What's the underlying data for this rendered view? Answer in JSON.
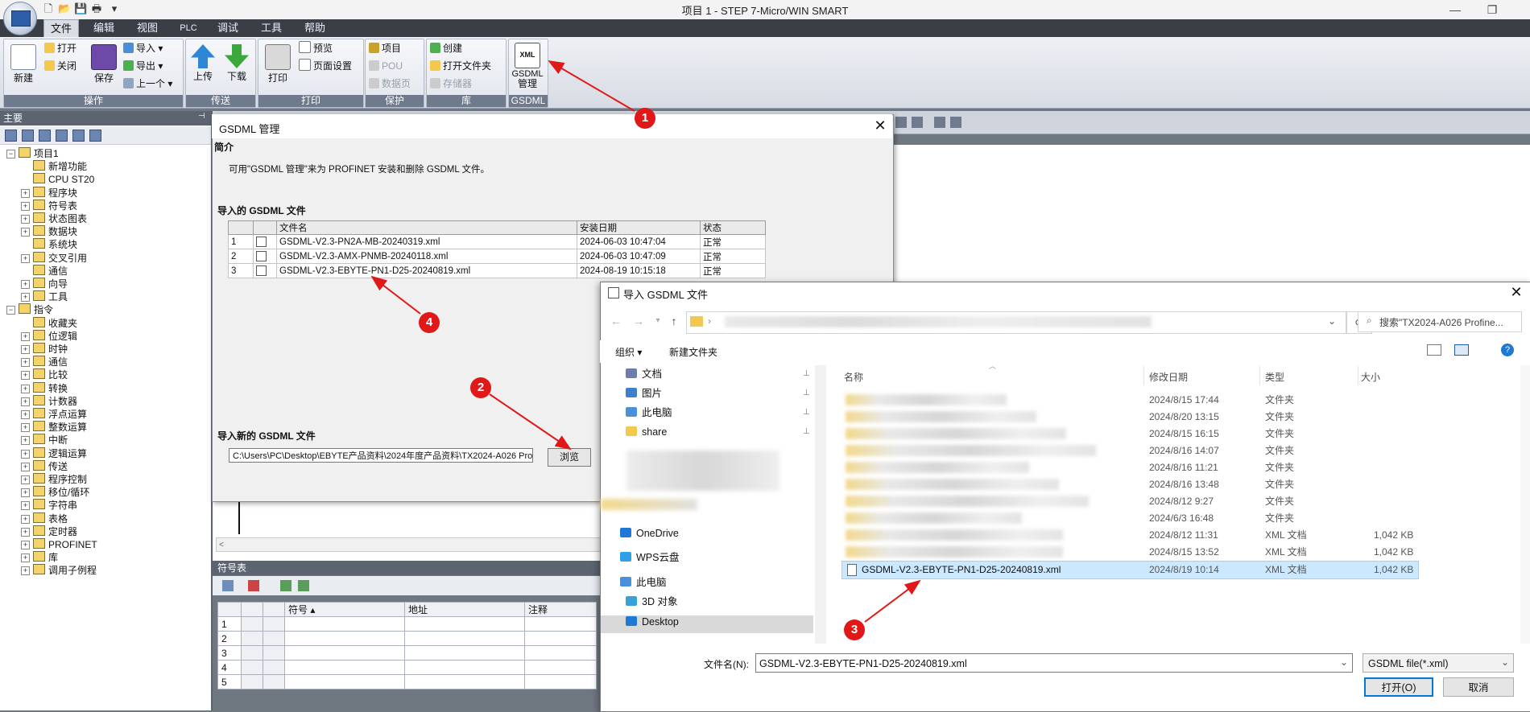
{
  "window": {
    "title": "项目 1 - STEP 7-Micro/WIN SMART",
    "controls": [
      "—",
      "❐"
    ]
  },
  "menu": {
    "tabs": [
      "文件",
      "编辑",
      "视图",
      "PLC",
      "调试",
      "工具",
      "帮助"
    ],
    "active": "文件"
  },
  "ribbon": {
    "ops": {
      "label": "操作",
      "new": "新建",
      "open": "打开",
      "close": "关闭",
      "save": "保存",
      "import": "导入 ▾",
      "export": "导出 ▾",
      "prev": "上一个 ▾"
    },
    "transfer": {
      "label": "传送",
      "upload": "上传",
      "download": "下载"
    },
    "print": {
      "label": "打印",
      "print": "打印",
      "preview": "预览",
      "page_setup": "页面设置"
    },
    "protect": {
      "label": "保护",
      "project": "项目",
      "pou": "POU",
      "data_page": "数据页"
    },
    "library": {
      "label": "库",
      "create": "创建",
      "open_folder": "打开文件夹",
      "storage": "存储器"
    },
    "gsdml": {
      "label": "GSDML",
      "btn_line1": "GSDML",
      "btn_line2": "管理",
      "icon_text": "XML"
    }
  },
  "left_panel": {
    "header": "主要",
    "tree": [
      {
        "label": "项目1",
        "exp": "−",
        "indent": 0
      },
      {
        "label": "新增功能",
        "exp": "",
        "indent": 1
      },
      {
        "label": "CPU ST20",
        "exp": "",
        "indent": 1
      },
      {
        "label": "程序块",
        "exp": "+",
        "indent": 1
      },
      {
        "label": "符号表",
        "exp": "+",
        "indent": 1
      },
      {
        "label": "状态图表",
        "exp": "+",
        "indent": 1
      },
      {
        "label": "数据块",
        "exp": "+",
        "indent": 1
      },
      {
        "label": "系统块",
        "exp": "",
        "indent": 1
      },
      {
        "label": "交叉引用",
        "exp": "+",
        "indent": 1
      },
      {
        "label": "通信",
        "exp": "",
        "indent": 1
      },
      {
        "label": "向导",
        "exp": "+",
        "indent": 1
      },
      {
        "label": "工具",
        "exp": "+",
        "indent": 1
      },
      {
        "label": "指令",
        "exp": "−",
        "indent": 0
      },
      {
        "label": "收藏夹",
        "exp": "",
        "indent": 1
      },
      {
        "label": "位逻辑",
        "exp": "+",
        "indent": 1
      },
      {
        "label": "时钟",
        "exp": "+",
        "indent": 1
      },
      {
        "label": "通信",
        "exp": "+",
        "indent": 1
      },
      {
        "label": "比较",
        "exp": "+",
        "indent": 1
      },
      {
        "label": "转换",
        "exp": "+",
        "indent": 1
      },
      {
        "label": "计数器",
        "exp": "+",
        "indent": 1
      },
      {
        "label": "浮点运算",
        "exp": "+",
        "indent": 1
      },
      {
        "label": "整数运算",
        "exp": "+",
        "indent": 1
      },
      {
        "label": "中断",
        "exp": "+",
        "indent": 1
      },
      {
        "label": "逻辑运算",
        "exp": "+",
        "indent": 1
      },
      {
        "label": "传送",
        "exp": "+",
        "indent": 1
      },
      {
        "label": "程序控制",
        "exp": "+",
        "indent": 1
      },
      {
        "label": "移位/循环",
        "exp": "+",
        "indent": 1
      },
      {
        "label": "字符串",
        "exp": "+",
        "indent": 1
      },
      {
        "label": "表格",
        "exp": "+",
        "indent": 1
      },
      {
        "label": "定时器",
        "exp": "+",
        "indent": 1
      },
      {
        "label": "PROFINET",
        "exp": "+",
        "indent": 1
      },
      {
        "label": "库",
        "exp": "+",
        "indent": 1
      },
      {
        "label": "调用子例程",
        "exp": "+",
        "indent": 1
      }
    ]
  },
  "symbol_table": {
    "header": "符号表",
    "columns": [
      "符号 ▴",
      "地址",
      "注释"
    ],
    "rows": [
      "1",
      "2",
      "3",
      "4",
      "5"
    ]
  },
  "gsdml_dialog": {
    "title": "GSDML 管理",
    "intro_heading": "简介",
    "intro_text": "可用\"GSDML 管理\"来为 PROFINET 安装和删除 GSDML 文件。",
    "imported_heading": "导入的 GSDML 文件",
    "columns": [
      "文件名",
      "安装日期",
      "状态"
    ],
    "rows": [
      {
        "no": "1",
        "name": "GSDML-V2.3-PN2A-MB-20240319.xml",
        "date": "2024-06-03 10:47:04",
        "status": "正常"
      },
      {
        "no": "2",
        "name": "GSDML-V2.3-AMX-PNMB-20240118.xml",
        "date": "2024-06-03 10:47:09",
        "status": "正常"
      },
      {
        "no": "3",
        "name": "GSDML-V2.3-EBYTE-PN1-D25-20240819.xml",
        "date": "2024-08-19 10:15:18",
        "status": "正常"
      }
    ],
    "import_new_heading": "导入新的 GSDML 文件",
    "path_value": "C:\\Users\\PC\\Desktop\\EBYTE产品资料\\2024年度产品资料\\TX2024-A026 Pro",
    "browse": "浏览",
    "close": "✕"
  },
  "file_dialog": {
    "title": "导入 GSDML 文件",
    "close": "✕",
    "search_placeholder": "搜索\"TX2024-A026 Profine...",
    "organize": "组织 ▾",
    "new_folder": "新建文件夹",
    "sidebar": [
      {
        "label": "文档",
        "color": "#6b7fa8",
        "pinned": true
      },
      {
        "label": "图片",
        "color": "#3f80c8",
        "pinned": true
      },
      {
        "label": "此电脑",
        "color": "#4a90d9",
        "pinned": true
      },
      {
        "label": "share",
        "color": "#f2c94c",
        "pinned": true
      },
      {
        "label": "OneDrive",
        "color": "#1e78d4",
        "pinned": false
      },
      {
        "label": "WPS云盘",
        "color": "#2fa0e8",
        "pinned": false
      },
      {
        "label": "此电脑",
        "color": "#4a90d9",
        "pinned": false
      },
      {
        "label": "3D 对象",
        "color": "#3aa0d8",
        "pinned": false
      },
      {
        "label": "Desktop",
        "color": "#1e78d4",
        "pinned": false
      }
    ],
    "columns": [
      "名称",
      "修改日期",
      "类型",
      "大小"
    ],
    "rows": [
      {
        "date": "2024/8/15 17:44",
        "type": "文件夹",
        "size": ""
      },
      {
        "date": "2024/8/20 13:15",
        "type": "文件夹",
        "size": ""
      },
      {
        "date": "2024/8/15 16:15",
        "type": "文件夹",
        "size": ""
      },
      {
        "date": "2024/8/16 14:07",
        "type": "文件夹",
        "size": ""
      },
      {
        "date": "2024/8/16 11:21",
        "type": "文件夹",
        "size": ""
      },
      {
        "date": "2024/8/16 13:48",
        "type": "文件夹",
        "size": ""
      },
      {
        "date": "2024/8/12 9:27",
        "type": "文件夹",
        "size": ""
      },
      {
        "date": "2024/6/3 16:48",
        "type": "文件夹",
        "size": ""
      },
      {
        "date": "2024/8/12 11:31",
        "type": "XML 文档",
        "size": "1,042 KB"
      },
      {
        "date": "2024/8/15 13:52",
        "type": "XML 文档",
        "size": "1,042 KB"
      }
    ],
    "selected_file": {
      "name": "GSDML-V2.3-EBYTE-PN1-D25-20240819.xml",
      "date": "2024/8/19 10:14",
      "type": "XML 文档",
      "size": "1,042 KB"
    },
    "filename_label": "文件名(N):",
    "filename_value": "GSDML-V2.3-EBYTE-PN1-D25-20240819.xml",
    "filetype": "GSDML file(*.xml)",
    "open": "打开(O)",
    "cancel": "取消"
  },
  "annotations": [
    "1",
    "2",
    "3",
    "4"
  ],
  "colors": {
    "accent": "#0078d7",
    "marker": "#e01818",
    "selection": "#cce8ff"
  }
}
